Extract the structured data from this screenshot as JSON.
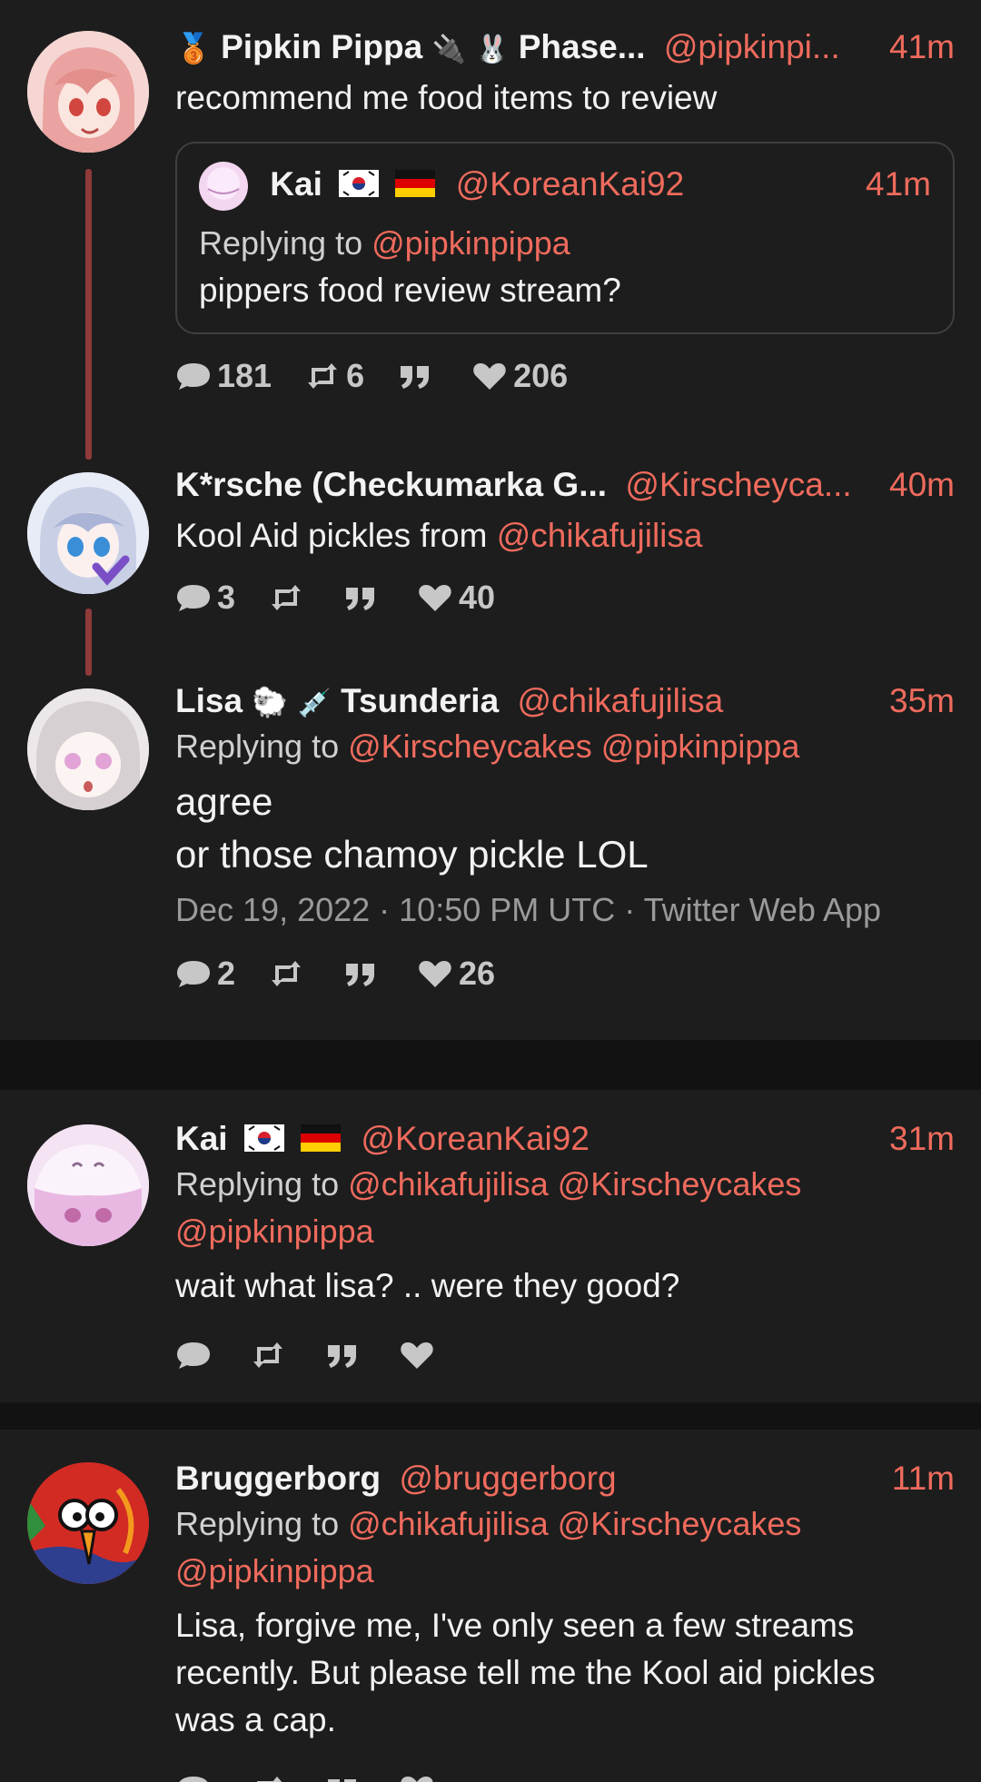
{
  "tweets": [
    {
      "name": "Pipkin Pippa",
      "name_suffix": "Phase...",
      "handle": "@pipkinpi...",
      "time": "41m",
      "text": "recommend me food items to review",
      "quote": {
        "name": "Kai",
        "handle": "@KoreanKai92",
        "time": "41m",
        "replying_prefix": "Replying to",
        "replying_to": "@pipkinpippa",
        "text": "pippers food review stream?"
      },
      "stats": {
        "replies": "181",
        "retweets": "6",
        "quotes": "",
        "likes": "206"
      }
    },
    {
      "name": "K*rsche (Checkumarka G...",
      "handle": "@Kirscheyca...",
      "time": "40m",
      "text": "Kool Aid pickles from",
      "text_mention": "@chikafujilisa",
      "stats": {
        "replies": "3",
        "retweets": "",
        "quotes": "",
        "likes": "40"
      }
    },
    {
      "name": "Lisa",
      "name_suffix": "Tsunderia",
      "handle": "@chikafujilisa",
      "time": "35m",
      "replying_prefix": "Replying to",
      "replying_to": "@Kirscheycakes @pipkinpippa",
      "text_line1": "agree",
      "text_line2": "or those chamoy pickle LOL",
      "meta": "Dec 19, 2022 · 10:50 PM UTC · Twitter Web App",
      "stats": {
        "replies": "2",
        "retweets": "",
        "quotes": "",
        "likes": "26"
      }
    },
    {
      "name": "Kai",
      "handle": "@KoreanKai92",
      "time": "31m",
      "replying_prefix": "Replying to",
      "replying_line1": "@chikafujilisa @Kirscheycakes",
      "replying_line2": "@pipkinpippa",
      "text": "wait what lisa? .. were they good?",
      "stats": {
        "replies": "",
        "retweets": "",
        "quotes": "",
        "likes": ""
      }
    },
    {
      "name": "Bruggerborg",
      "handle": "@bruggerborg",
      "time": "11m",
      "replying_prefix": "Replying to",
      "replying_line1": "@chikafujilisa @Kirscheycakes",
      "replying_line2": "@pipkinpippa",
      "text_line1": "Lisa, forgive me, I've only seen a few streams",
      "text_line2": "recently. But please tell me the Kool aid pickles",
      "text_line3": "was a cap."
    }
  ],
  "colors": {
    "background": "#1d1d1d",
    "separator": "#121212",
    "accent": "#ef6b5d",
    "thread_line": "#8e3a39"
  }
}
